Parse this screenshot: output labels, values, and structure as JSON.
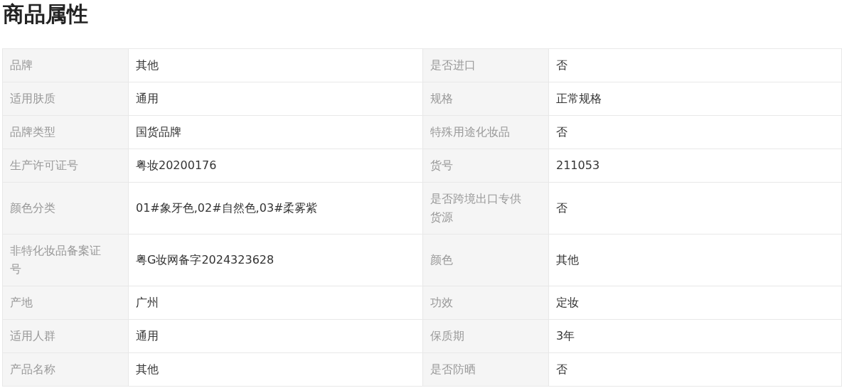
{
  "title": "商品属性",
  "rows": [
    [
      {
        "label": "品牌",
        "value": "其他"
      },
      {
        "label": "是否进口",
        "value": "否"
      }
    ],
    [
      {
        "label": "适用肤质",
        "value": "通用"
      },
      {
        "label": "规格",
        "value": "正常规格"
      }
    ],
    [
      {
        "label": "品牌类型",
        "value": "国货品牌"
      },
      {
        "label": "特殊用途化妆品",
        "value": "否"
      }
    ],
    [
      {
        "label": "生产许可证号",
        "value": "粤妆20200176"
      },
      {
        "label": "货号",
        "value": "211053"
      }
    ],
    [
      {
        "label": "颜色分类",
        "value": "01#象牙色,02#自然色,03#柔雾紫"
      },
      {
        "label": "是否跨境出口专供货源",
        "value": "否"
      }
    ],
    [
      {
        "label": "非特化妆品备案证号",
        "value": "粤G妆网备字2024323628"
      },
      {
        "label": "颜色",
        "value": "其他"
      }
    ],
    [
      {
        "label": "产地",
        "value": "广州"
      },
      {
        "label": "功效",
        "value": "定妆"
      }
    ],
    [
      {
        "label": "适用人群",
        "value": "通用"
      },
      {
        "label": "保质期",
        "value": "3年"
      }
    ],
    [
      {
        "label": "产品名称",
        "value": "其他"
      },
      {
        "label": "是否防晒",
        "value": "否"
      }
    ]
  ]
}
